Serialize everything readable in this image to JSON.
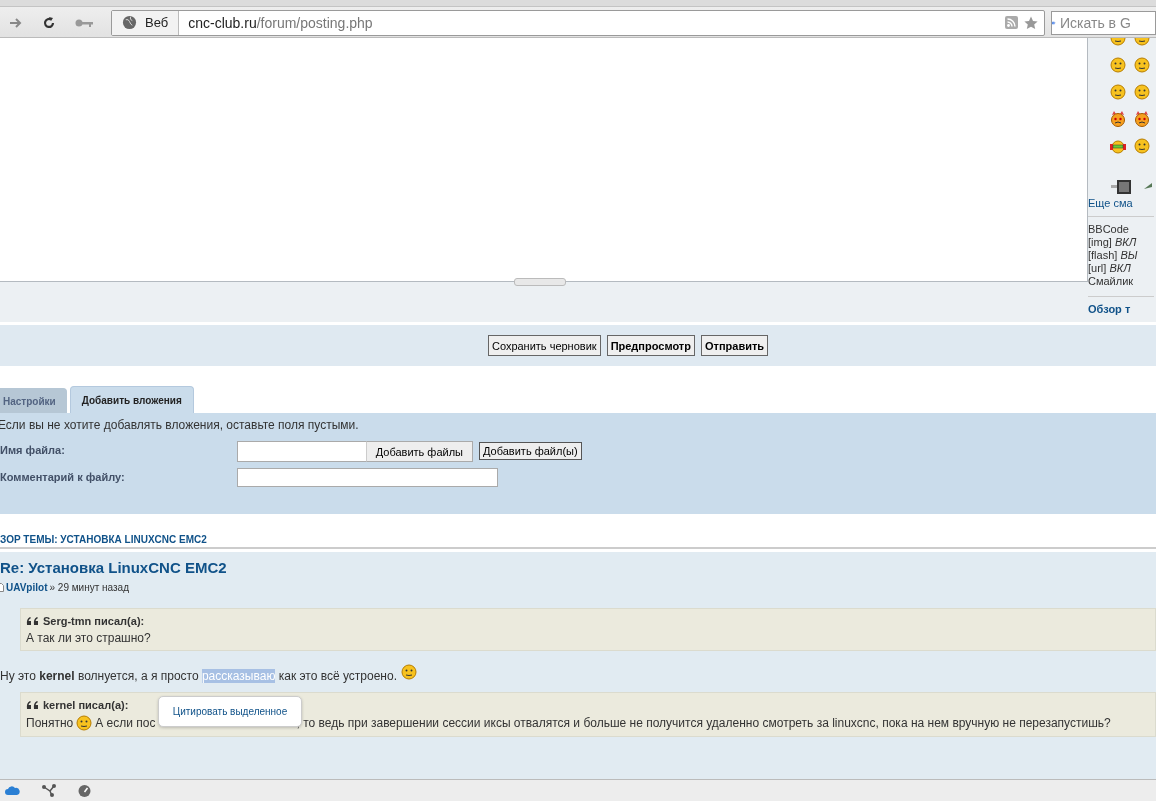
{
  "browser": {
    "address_label": "Веб",
    "url_host": "cnc-club.ru",
    "url_path": "/forum/posting.php",
    "search_placeholder": "Искать в G"
  },
  "sidebar": {
    "more_smileys_link": "Еще сма",
    "bbcode_lines": [
      "BBCode",
      "[img] *ВКЛ*",
      "[flash] *ВЫ*",
      "[url] *ВКЛ*",
      "Смайлик"
    ],
    "topic_review_link": "Обзор т"
  },
  "actions": [
    {
      "label": "Сохранить черновик",
      "primary": false
    },
    {
      "label": "Предпросмотр",
      "primary": true
    },
    {
      "label": "Отправить",
      "primary": true
    }
  ],
  "tabs": [
    {
      "label": "Настройки",
      "selected": false
    },
    {
      "label": "Добавить вложения",
      "selected": true
    }
  ],
  "attachments": {
    "hint": "Если вы не хотите добавлять вложения, оставьте поля пустыми.",
    "file_label": "Имя файла:",
    "browse_button": "Добавить файлы",
    "add_button": "Добавить файл(ы)",
    "comment_label": "Комментарий к файлу:"
  },
  "topic_review": {
    "heading": "ЗОР ТЕМЫ: УСТАНОВКА LINUXCNC EMC2",
    "post": {
      "title": "Re: Установка LinuxCNC EMC2",
      "author": "UAVpilot",
      "time": "» 29 минут назад",
      "quote_1": {
        "author": "Serg-tmn писал(а):",
        "text": "А так ли это страшно?"
      },
      "body": {
        "before": "Ну это **kernel** волнуется, а я просто ",
        "selected_text": "рассказываю",
        "after": " как это всё устроено."
      },
      "quote_2": {
        "author": "kernel писал(а):",
        "text_start": "Понятно",
        "text_mid": "А если пос",
        "text_end": ", то ведь при завершении сессии иксы отвалятся и больше не получится удаленно смотреть за linuxcnc, пока на нем вручную не перезапустишь?"
      }
    }
  },
  "tooltip": {
    "label": "Цитировать выделенное"
  }
}
